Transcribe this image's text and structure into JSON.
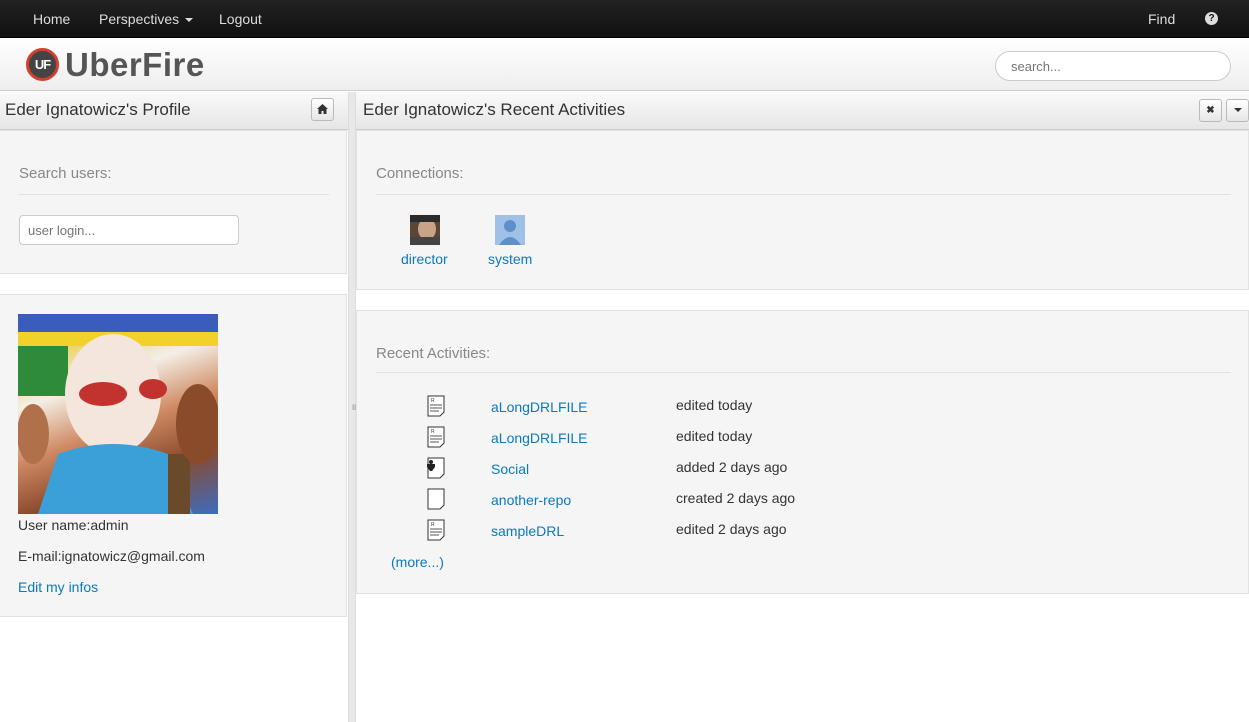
{
  "navbar": {
    "home": "Home",
    "perspectives": "Perspectives",
    "logout": "Logout",
    "find": "Find",
    "help_icon": "question-circle-icon"
  },
  "header": {
    "logo_mark": "UF",
    "logo_text": "UberFire",
    "search_placeholder": "search..."
  },
  "profile_panel": {
    "title": "Eder Ignatowicz's Profile",
    "home_icon": "home-icon",
    "search_users_label": "Search users:",
    "user_login_placeholder": "user login...",
    "user_name": "User name:admin",
    "email": "E-mail:ignatowicz@gmail.com",
    "edit_link": "Edit my infos"
  },
  "activities_panel": {
    "title": "Eder Ignatowicz's Recent Activities",
    "close_icon": "close-icon",
    "menu_icon": "caret-down-icon",
    "connections_label": "Connections:",
    "connections": [
      {
        "name": "director",
        "avatar": "photo"
      },
      {
        "name": "system",
        "avatar": "default-user"
      }
    ],
    "recent_label": "Recent Activities:",
    "activities": [
      {
        "icon": "drl-file-icon",
        "name": "aLongDRLFILE",
        "action": "edited today"
      },
      {
        "icon": "drl-file-icon",
        "name": "aLongDRLFILE",
        "action": "edited today"
      },
      {
        "icon": "repo-icon",
        "name": "Social",
        "action": "added 2 days ago"
      },
      {
        "icon": "blank-file-icon",
        "name": "another-repo",
        "action": "created 2 days ago"
      },
      {
        "icon": "drl-file-icon",
        "name": "sampleDRL",
        "action": "edited 2 days ago"
      }
    ],
    "more_link": "(more...)"
  },
  "colors": {
    "link": "#0a78c2",
    "navbar_bg": "#111111",
    "logo_accent": "#d0402d"
  }
}
